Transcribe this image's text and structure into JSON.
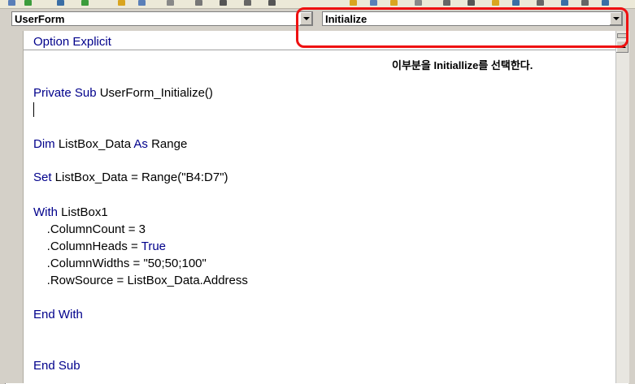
{
  "combos": {
    "object": "UserForm",
    "procedure": "Initialize"
  },
  "annotation": "이부분을 Initiallize를 선택한다.",
  "code": {
    "line1": "Option Explicit",
    "line2_kw": "Private Sub",
    "line2_rest": " UserForm_Initialize()",
    "line3_kw1": "Dim",
    "line3_mid": " ListBox_Data ",
    "line3_kw2": "As",
    "line3_rest": " Range",
    "line4_kw": "Set",
    "line4_rest": " ListBox_Data = Range(\"B4:D7\")",
    "line5_kw": "With",
    "line5_rest": " ListBox1",
    "line6": "    .ColumnCount = 3",
    "line7_pre": "    .ColumnHeads = ",
    "line7_kw": "True",
    "line8": "    .ColumnWidths = \"50;50;100\"",
    "line9": "    .RowSource = ListBox_Data.Address",
    "line10": "End With",
    "line11": "End Sub"
  },
  "colors": {
    "keyword": "#00008b",
    "highlight": "#ee1111"
  }
}
